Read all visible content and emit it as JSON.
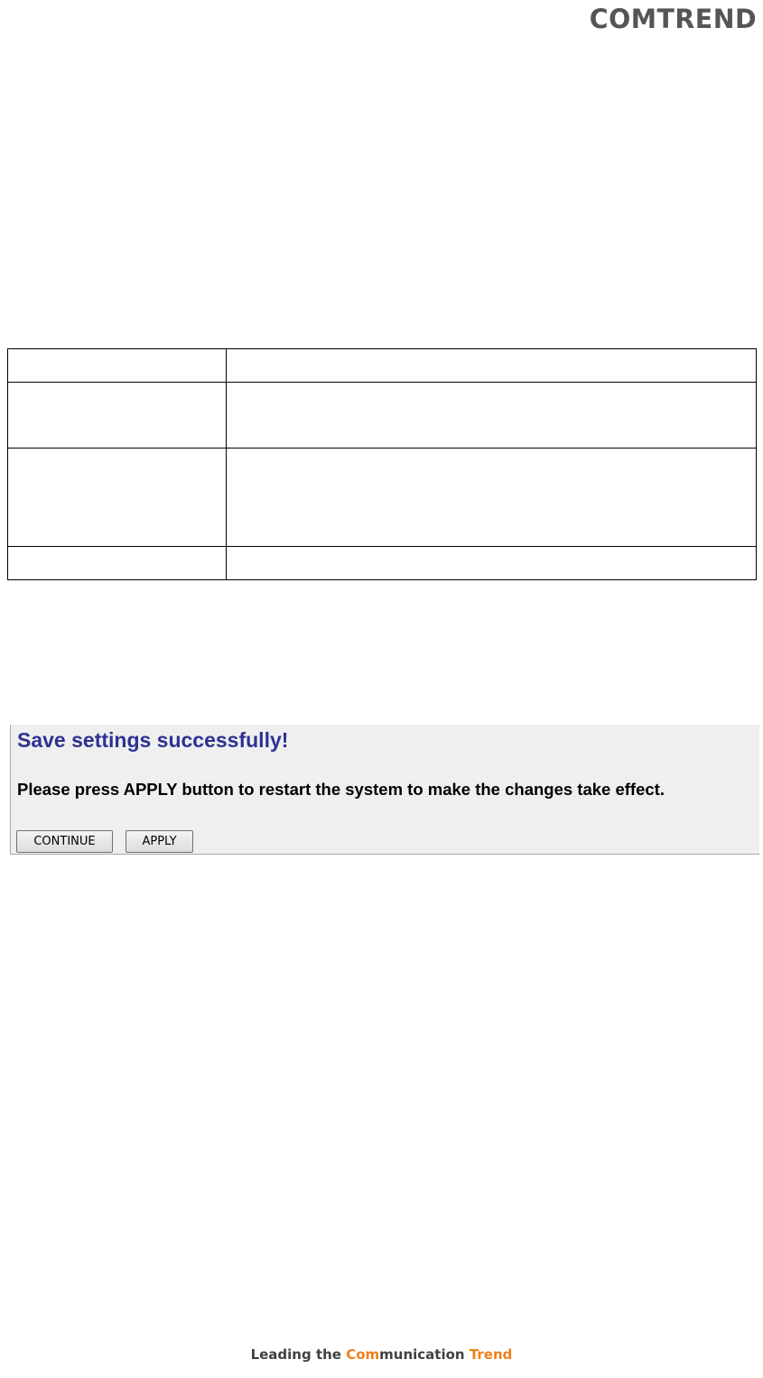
{
  "header": {
    "logo_text": "COMTREND"
  },
  "table": {
    "rows": [
      [
        "",
        ""
      ],
      [
        "",
        ""
      ],
      [
        "",
        ""
      ],
      [
        "",
        ""
      ]
    ]
  },
  "save_panel": {
    "title": "Save settings successfully!",
    "message": "Please press APPLY button to restart the system to make the changes take effect.",
    "continue_label": "CONTINUE",
    "apply_label": "APPLY"
  },
  "footer": {
    "part1": "Leading the ",
    "part2": "Com",
    "part3": "munication ",
    "part4": "Trend"
  },
  "colors": {
    "title_blue": "#2e3192",
    "accent_orange": "#f07f1a",
    "panel_bg": "#efefef"
  }
}
